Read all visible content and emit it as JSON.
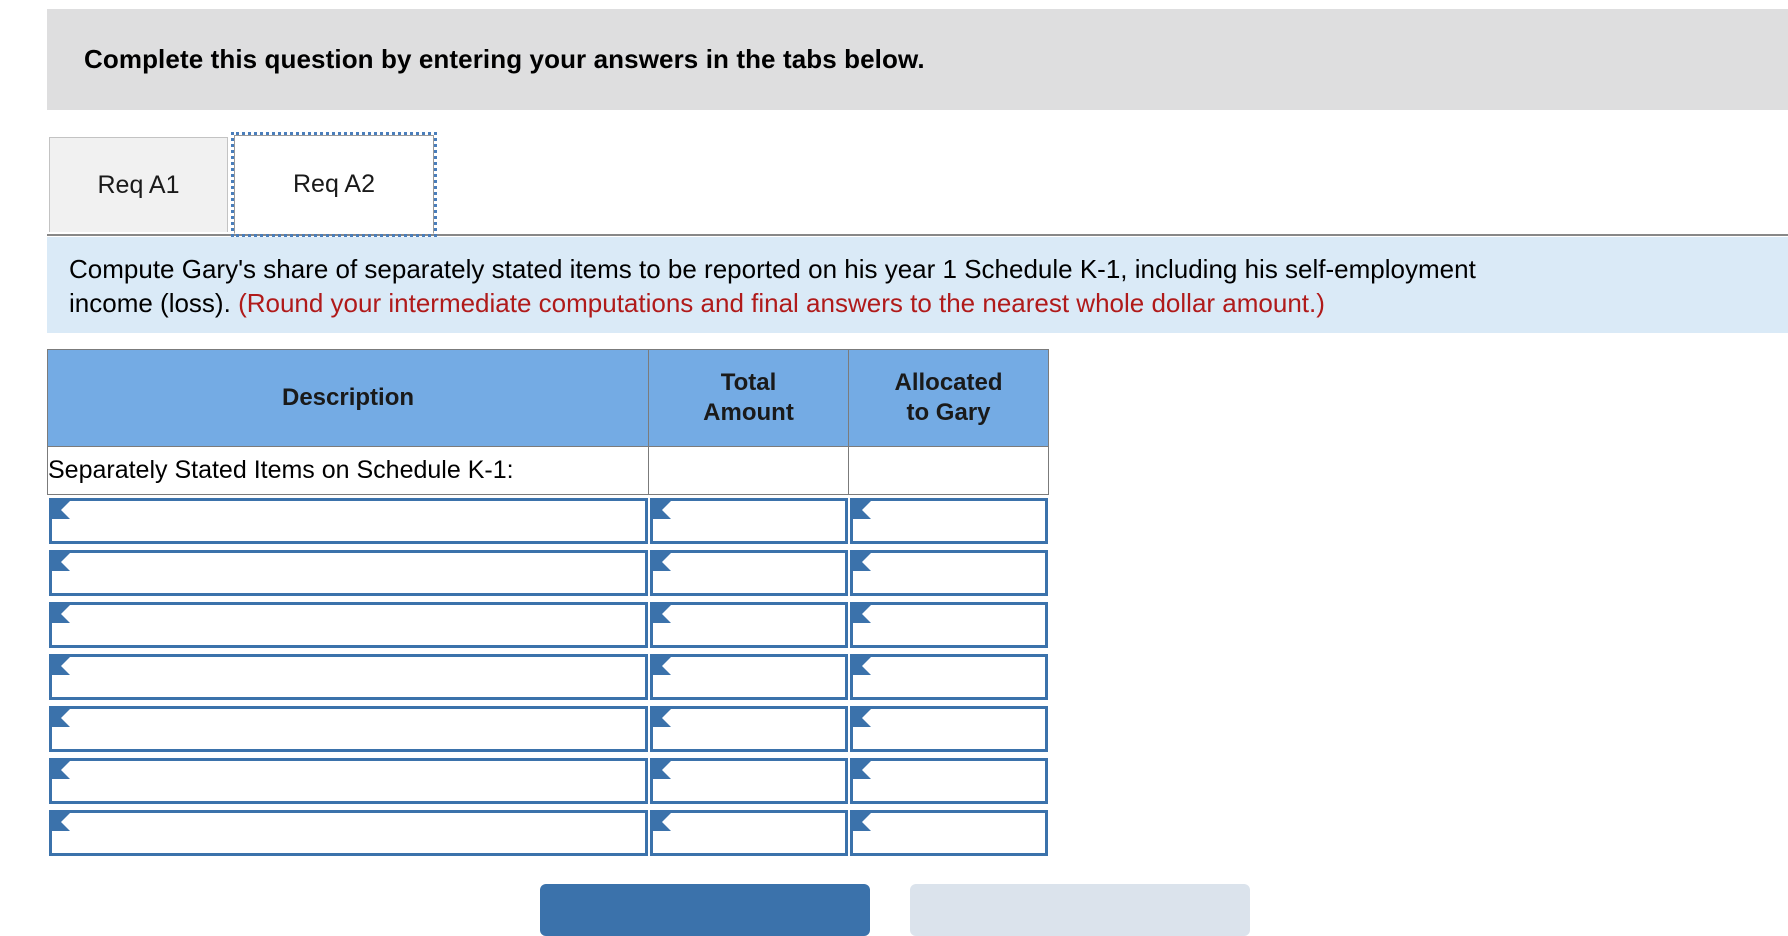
{
  "banner": {
    "text": "Complete this question by entering your answers in the tabs below."
  },
  "tabs": [
    {
      "label": "Req A1",
      "active": false
    },
    {
      "label": "Req A2",
      "active": true
    }
  ],
  "instruction": {
    "line1": "Compute Gary's share of separately stated items to be reported on his year 1 Schedule K-1, including his self-employment",
    "line2_black": "income (loss).",
    "line2_red": "(Round your intermediate computations and final answers to the nearest whole dollar amount.)"
  },
  "table": {
    "headers": {
      "description": "Description",
      "total_amount_l1": "Total",
      "total_amount_l2": "Amount",
      "allocated_l1": "Allocated",
      "allocated_l2": "to Gary"
    },
    "label_row": "Separately Stated Items on Schedule K-1:",
    "input_rows": [
      {
        "description": "",
        "total_amount": "",
        "allocated": ""
      },
      {
        "description": "",
        "total_amount": "",
        "allocated": ""
      },
      {
        "description": "",
        "total_amount": "",
        "allocated": ""
      },
      {
        "description": "",
        "total_amount": "",
        "allocated": ""
      },
      {
        "description": "",
        "total_amount": "",
        "allocated": ""
      },
      {
        "description": "",
        "total_amount": "",
        "allocated": ""
      },
      {
        "description": "",
        "total_amount": "",
        "allocated": ""
      }
    ]
  },
  "footer_buttons": {
    "primary": "",
    "secondary": ""
  },
  "colors": {
    "banner_gray": "#dededf",
    "instruction_blue": "#daeaf7",
    "header_blue": "#74abe4",
    "input_border_blue": "#3b72ab",
    "warning_red": "#b01a1a",
    "tab_focus_blue": "#4a7ebb"
  }
}
